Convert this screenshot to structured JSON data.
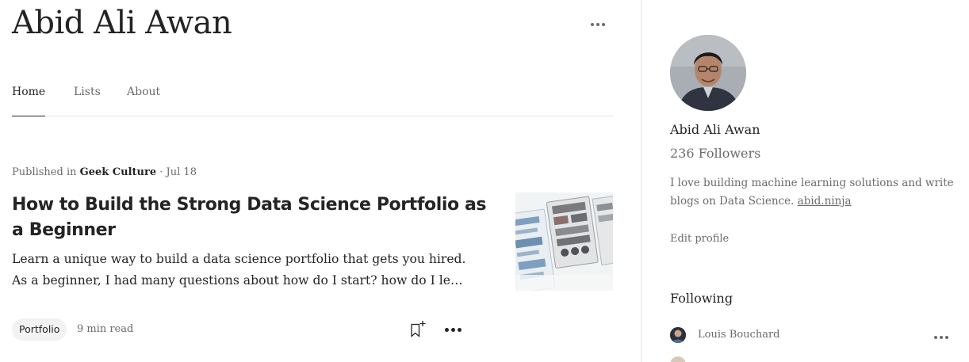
{
  "header": {
    "profile_name": "Abid Ali Awan"
  },
  "tabs": [
    {
      "label": "Home",
      "active": true
    },
    {
      "label": "Lists",
      "active": false
    },
    {
      "label": "About",
      "active": false
    }
  ],
  "article": {
    "published_prefix": "Published in",
    "publication": "Geek Culture",
    "separator": "·",
    "date": "Jul 18",
    "title": "How to Build the Strong Data Science Portfolio as a Beginner",
    "excerpt_line1": "Learn a unique way to build a data science portfolio that gets you hired.",
    "excerpt_line2": "As a beginner, I had many questions about how do I start? how do I lea…",
    "tag": "Portfolio",
    "read_time": "9 min read"
  },
  "sidebar": {
    "name": "Abid Ali Awan",
    "followers": "236 Followers",
    "bio": "I love building machine learning solutions and write blogs on Data Science.",
    "bio_link": "abid.ninja",
    "edit_profile": "Edit profile",
    "following_title": "Following",
    "following": [
      {
        "name": "Louis Bouchard"
      }
    ]
  },
  "icons": {
    "header_more": "more-horizontal-icon",
    "bookmark": "bookmark-add-icon",
    "article_more": "more-horizontal-icon",
    "follow_more": "more-horizontal-icon"
  },
  "colors": {
    "text_primary": "#242424",
    "text_secondary": "#6b6b6b",
    "divider": "#e6e6e6",
    "tag_bg": "#f2f2f2"
  }
}
